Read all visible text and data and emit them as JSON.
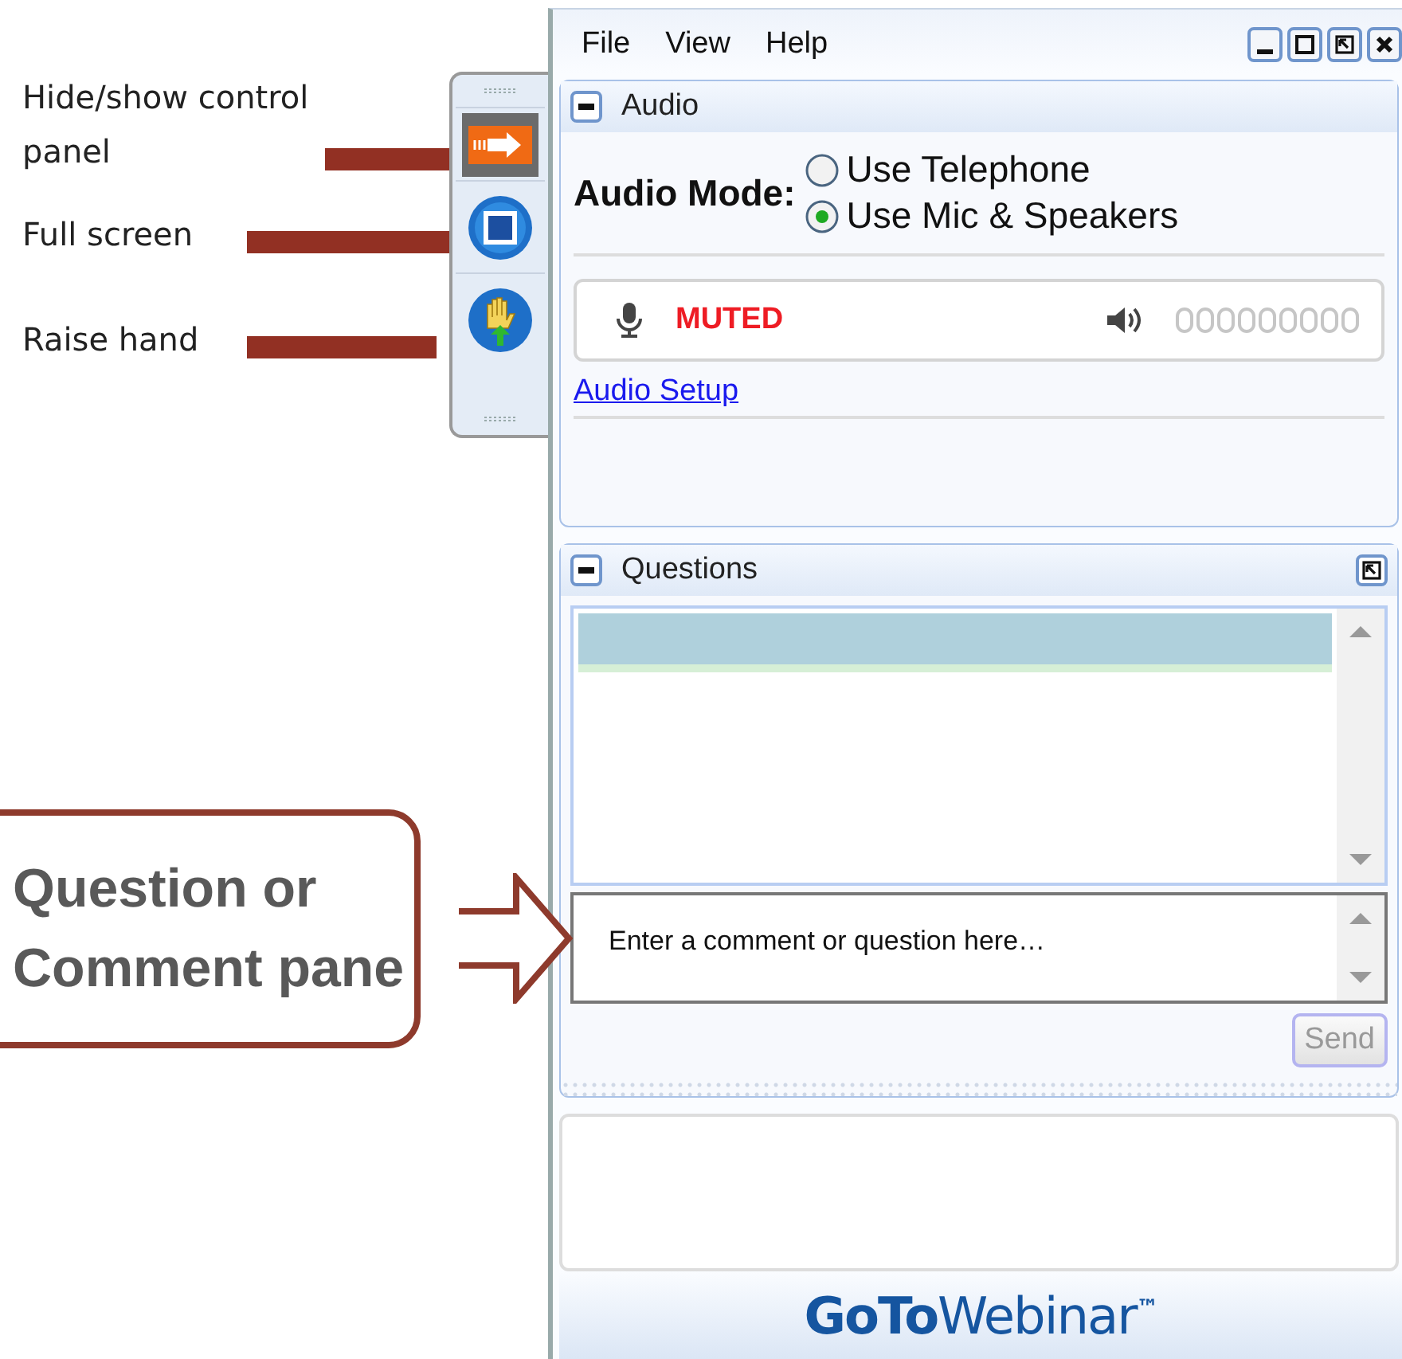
{
  "annotations": [
    {
      "label": "Hide/show control panel"
    },
    {
      "label": "Full screen"
    },
    {
      "label": "Raise hand"
    }
  ],
  "callout": {
    "label": "Question or Comment pane"
  },
  "menu": [
    "File",
    "View",
    "Help"
  ],
  "audio": {
    "title": "Audio",
    "mode_label": "Audio Mode:",
    "options": [
      {
        "label": "Use Telephone",
        "selected": false
      },
      {
        "label": "Use Mic & Speakers",
        "selected": true
      }
    ],
    "mic_status": "MUTED",
    "speaker": {
      "level": 0
    },
    "setup_link": "Audio Setup"
  },
  "questions": {
    "title": "Questions",
    "input": {
      "placeholder": "Enter a comment or question here…"
    },
    "send": {
      "label": "Send",
      "disabled": true
    }
  },
  "logo": {
    "bold": "GoTo",
    "light": "Webinar",
    "mark": "™"
  }
}
